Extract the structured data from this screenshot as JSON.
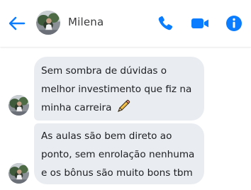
{
  "header": {
    "contact_name": "Milena",
    "back_icon": "arrow-left-icon",
    "call_icon": "phone-icon",
    "video_icon": "video-camera-icon",
    "info_icon": "info-icon"
  },
  "messages": [
    {
      "lines": [
        "Sem sombra de dúvidas o",
        "melhor investimento que fiz na",
        "minha carreira"
      ],
      "emoji": "pencil-icon"
    },
    {
      "lines": [
        "As aulas são bem direto ao",
        "ponto, sem enrolação nenhuma",
        "e os bônus são muito bons tbm"
      ]
    }
  ],
  "colors": {
    "accent": "#0a7cff",
    "bubble": "#e9ecf1",
    "text": "#1c1e21"
  }
}
